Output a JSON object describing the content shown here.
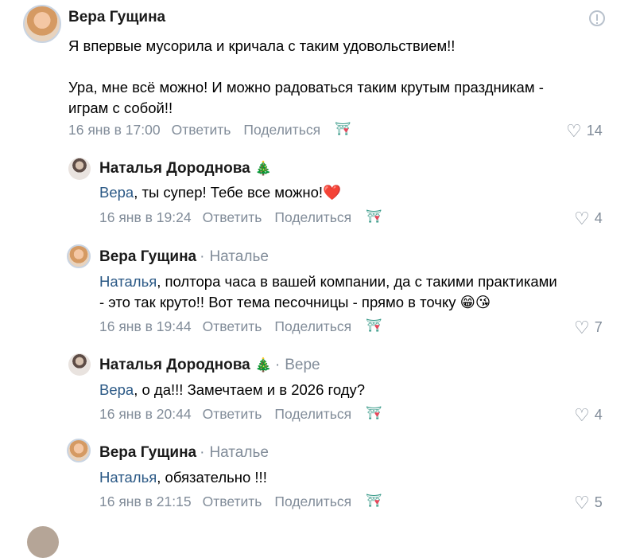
{
  "actions": {
    "reply": "Ответить",
    "share": "Поделиться"
  },
  "comments": [
    {
      "author": "Вера Гущина",
      "line1": "Я впервые мусорила и кричала с таким удовольствием!!",
      "line2": "Ура, мне всё можно! И можно радоваться таким крутым праздникам -",
      "line3": "играм с собой!!",
      "time": "16 янв в 17:00",
      "likes": "14"
    },
    {
      "author": "Наталья Дороднова",
      "tree": "🎄",
      "mention": "Вера",
      "text": ", ты супер! Тебе все можно!❤️",
      "time": "16 янв в 19:24",
      "likes": "4"
    },
    {
      "author": "Вера Гущина",
      "reply_to": "Наталье",
      "mention": "Наталья",
      "text_line1": ", полтора часа в вашей компании, да с такими практиками",
      "text_line2": "- это так круто!! Вот тема песочницы - прямо в точку 😁😘",
      "time": "16 янв в 19:44",
      "likes": "7"
    },
    {
      "author": "Наталья Дороднова",
      "tree": "🎄",
      "reply_to": "Вере",
      "mention": "Вера",
      "text": ", о да!!! Замечтаем и в 2026 году?",
      "time": "16 янв в 20:44",
      "likes": "4"
    },
    {
      "author": "Вера Гущина",
      "reply_to": "Наталье",
      "mention": "Наталья",
      "text": ", обязательно !!!",
      "time": "16 янв в 21:15",
      "likes": "5"
    }
  ]
}
